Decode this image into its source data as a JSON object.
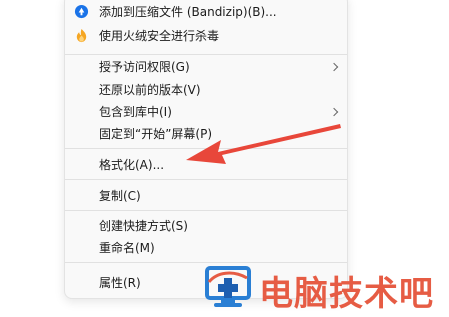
{
  "menu": {
    "items": [
      {
        "label": "添加到压缩文件 (Bandizip)(B)...",
        "icon": "bandizip-icon"
      },
      {
        "label": "使用火绒安全进行杀毒",
        "icon": "huorong-icon"
      },
      {
        "label": "授予访问权限(G)",
        "submenu": true
      },
      {
        "label": "还原以前的版本(V)"
      },
      {
        "label": "包含到库中(I)",
        "submenu": true
      },
      {
        "label": "固定到“开始”屏幕(P)"
      },
      {
        "label": "格式化(A)..."
      },
      {
        "label": "复制(C)"
      },
      {
        "label": "创建快捷方式(S)"
      },
      {
        "label": "重命名(M)"
      },
      {
        "label": "属性(R)"
      }
    ]
  },
  "watermark": {
    "text": "电脑技术吧",
    "icon": "computer-monitor-logo-icon"
  },
  "annotation": {
    "icon": "red-arrow-pointer-icon",
    "color": "#e8473a"
  },
  "colors": {
    "menu_bg": "#f9f9f9",
    "watermark": "#e65c44",
    "bandizip": "#1a73e8",
    "huorong": "#f5a623"
  }
}
